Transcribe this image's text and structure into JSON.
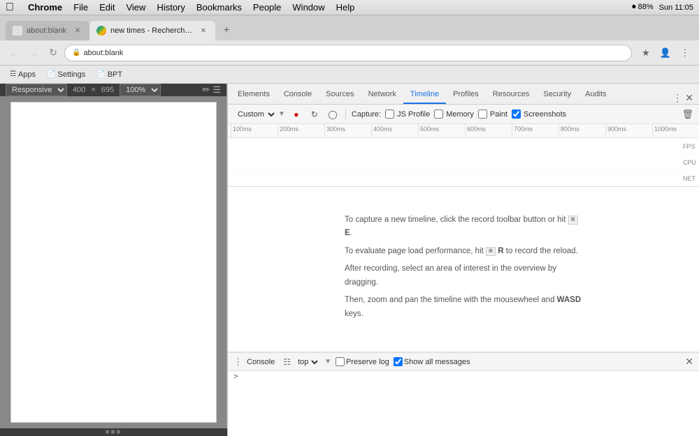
{
  "menu_bar": {
    "apple": "&#63743;",
    "chrome": "Chrome",
    "file": "File",
    "edit": "Edit",
    "view": "View",
    "history": "History",
    "bookmarks": "Bookmarks",
    "people": "People",
    "window": "Window",
    "help": "Help",
    "right": {
      "time": "Sun 11:05",
      "battery": "88%",
      "wifi": "&#8984;"
    }
  },
  "tabs": [
    {
      "title": "about:blank",
      "active": false,
      "favicon": "blank"
    },
    {
      "title": "new times - Recherche G...",
      "active": true,
      "favicon": "google"
    }
  ],
  "nav": {
    "address": "about:blank"
  },
  "bookmarks": [
    {
      "label": "Apps",
      "icon": "&#9782;"
    },
    {
      "label": "Settings",
      "icon": "&#128196;"
    },
    {
      "label": "BPT",
      "icon": "&#128196;"
    }
  ],
  "responsive": {
    "preset": "Responsive",
    "width": "400",
    "x": "×",
    "height": "695",
    "zoom": "100%"
  },
  "devtools": {
    "tabs": [
      "Elements",
      "Console",
      "Sources",
      "Network",
      "Timeline",
      "Profiles",
      "Resources",
      "Security",
      "Audits"
    ],
    "active_tab": "Timeline"
  },
  "timeline": {
    "preset": "Custom",
    "capture_label": "Capture:",
    "checkboxes": {
      "js_profile": "JS Profile",
      "memory": "Memory",
      "paint": "Paint",
      "screenshots": "Screenshots"
    },
    "ruler_ticks": [
      "100ms",
      "200ms",
      "300ms",
      "400ms",
      "500ms",
      "600ms",
      "700ms",
      "800ms",
      "900ms",
      "1000ms"
    ],
    "right_labels": [
      "FPS",
      "CPU",
      "NET"
    ],
    "empty_msg_line1": "To capture a new timeline, click the record toolbar button or hit ⌘ E.",
    "empty_msg_line2": "To evaluate page load performance, hit ⌘ R to record the reload.",
    "empty_msg_line3": "After recording, select an area of interest in the overview by dragging.",
    "empty_msg_line4": "Then, zoom and pan the timeline with the mousewheel and WASD keys."
  },
  "console": {
    "title": "Console",
    "filter_icon": "&#9783;",
    "top_option": "top",
    "preserve_log": "Preserve log",
    "show_all_messages": "Show all messages",
    "prompt_arrow": ">"
  }
}
